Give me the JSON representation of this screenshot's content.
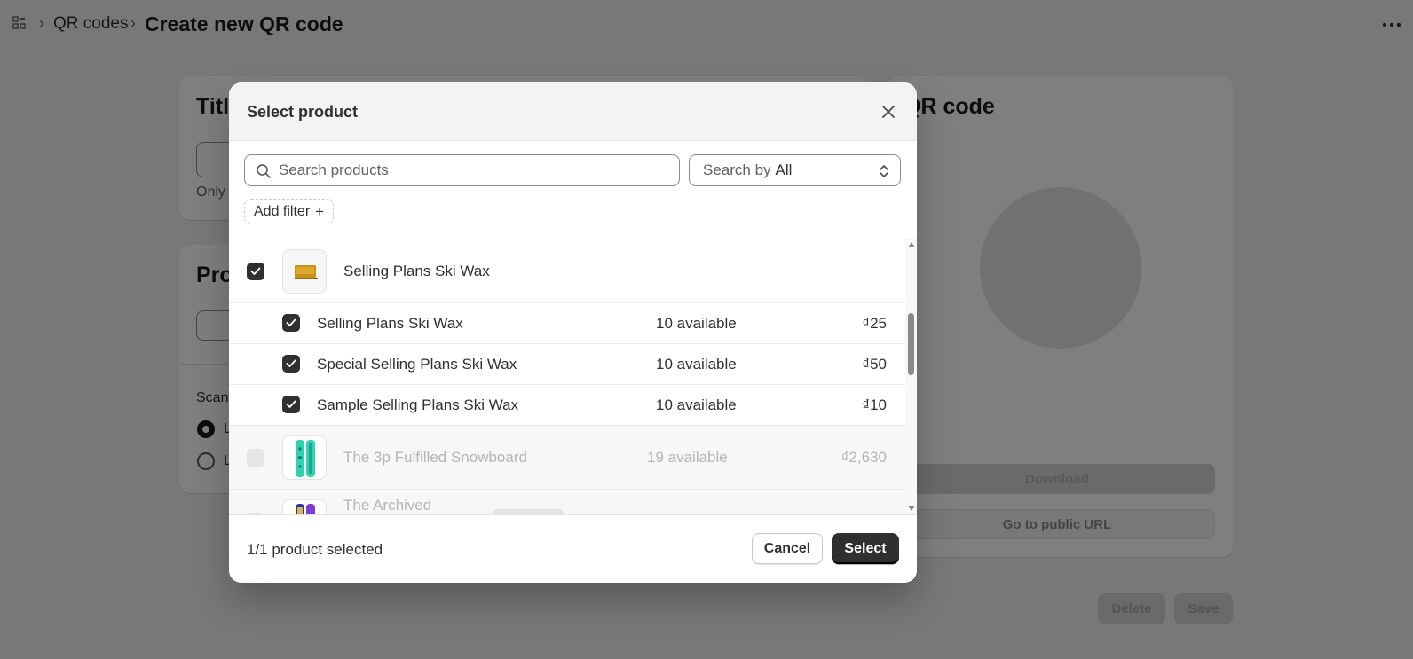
{
  "breadcrumb": {
    "link": "QR codes",
    "title": "Create new QR code"
  },
  "background": {
    "title_card_heading": "Title",
    "title_help": "Only",
    "product_card_heading": "Pro",
    "scan_label": "Scan",
    "radio_1_label": "L",
    "radio_2_label": "L",
    "qr_card_heading": "QR code",
    "download_label": "Download",
    "public_url_label": "Go to public URL",
    "delete_label": "Delete",
    "save_label": "Save"
  },
  "modal": {
    "title": "Select product",
    "search": {
      "placeholder": "Search products",
      "value": ""
    },
    "search_by": {
      "prefix": "Search by",
      "value": "All"
    },
    "add_filter_label": "Add filter",
    "products": [
      {
        "name": "Selling Plans Ski Wax",
        "checked": true,
        "thumb_icon": "ski-wax-icon",
        "variants": [
          {
            "name": "Selling Plans Ski Wax",
            "availability": "10 available",
            "price": "₫25"
          },
          {
            "name": "Special Selling Plans Ski Wax",
            "availability": "10 available",
            "price": "₫50"
          },
          {
            "name": "Sample Selling Plans Ski Wax",
            "availability": "10 available",
            "price": "₫10"
          }
        ]
      },
      {
        "name": "The 3p Fulfilled Snowboard",
        "availability": "19 available",
        "price": "₫2,630",
        "disabled": true,
        "thumb_icon": "snowboard-icon"
      },
      {
        "name": "The Archived",
        "disabled": true,
        "thumb_icon": "snowboard-icon"
      }
    ],
    "footer": {
      "selection_count": "1/1 product selected",
      "cancel_label": "Cancel",
      "select_label": "Select"
    }
  },
  "colors": {
    "primary_button": "#303030",
    "overlay": "rgba(0,0,0,0.5)",
    "muted_text": "#b5b5b5"
  }
}
